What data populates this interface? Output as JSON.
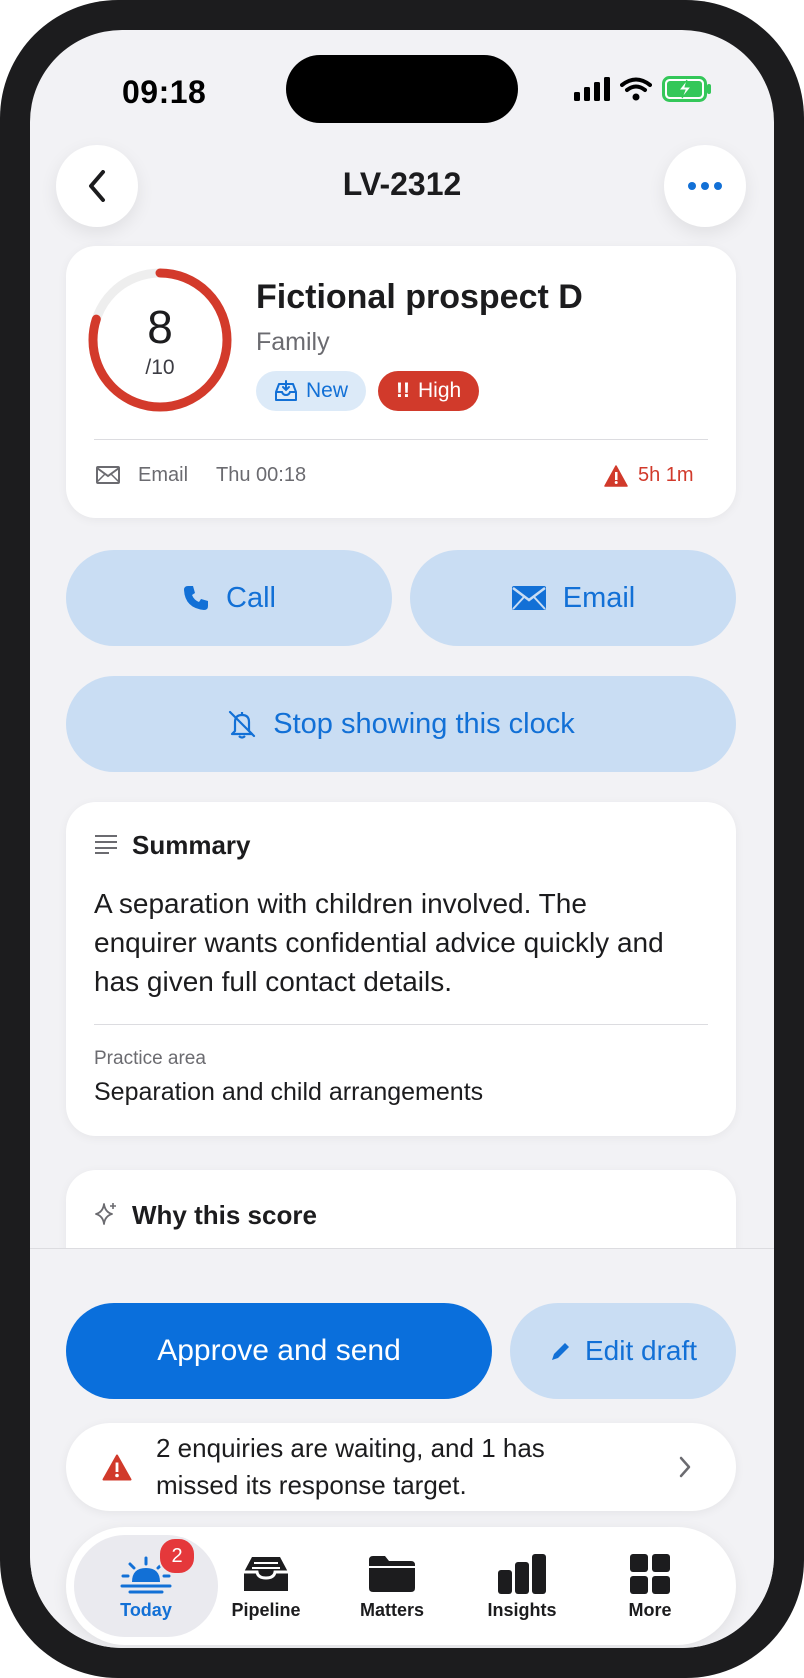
{
  "status_bar": {
    "time": "09:18"
  },
  "header": {
    "title": "LV-2312",
    "back_icon": "chevron-left-icon",
    "more_icon": "ellipsis-icon"
  },
  "lead": {
    "score": "8",
    "score_max": "/10",
    "score_fraction": 0.8,
    "name": "Fictional prospect D",
    "category": "Family",
    "badge_new": "New",
    "badge_high": "High",
    "channel": "Email",
    "received": "Thu 00:18",
    "timer": "5h 1m"
  },
  "actions": {
    "call": "Call",
    "email": "Email",
    "stop_clock": "Stop showing this clock"
  },
  "summary": {
    "heading": "Summary",
    "text": "A separation with children involved. The enquirer wants confidential advice quickly and has given full contact details.",
    "practice_area_label": "Practice area",
    "practice_area_value": "Separation and child arrangements"
  },
  "why": {
    "heading": "Why this score"
  },
  "footer": {
    "approve": "Approve and send",
    "edit": "Edit draft"
  },
  "alert": {
    "text": "2 enquiries are waiting, and 1 has missed its response target."
  },
  "tab_bar": {
    "items": [
      {
        "label": "Today",
        "icon": "sunrise-icon",
        "badge": "2"
      },
      {
        "label": "Pipeline",
        "icon": "tray-icon"
      },
      {
        "label": "Matters",
        "icon": "folder-icon"
      },
      {
        "label": "Insights",
        "icon": "bar-chart-icon"
      },
      {
        "label": "More",
        "icon": "grid-icon"
      }
    ]
  },
  "colors": {
    "accent": "#0a6fdc",
    "danger": "#d13a2b",
    "button_tint": "#c9ddf3"
  }
}
